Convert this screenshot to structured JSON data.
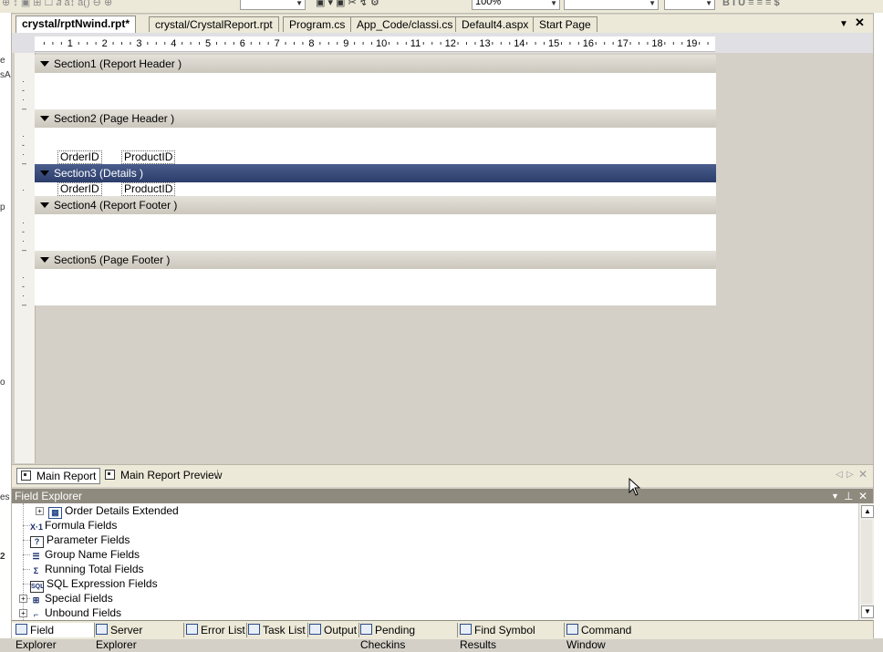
{
  "toolbar": {
    "zoom": "100%"
  },
  "doc_tabs": [
    {
      "label": "crystal/rptNwind.rpt*",
      "active": true
    },
    {
      "label": "crystal/CrystalReport.rpt"
    },
    {
      "label": "Program.cs"
    },
    {
      "label": "App_Code/classi.cs"
    },
    {
      "label": "Default4.aspx"
    },
    {
      "label": "Start Page"
    }
  ],
  "ruler": {
    "numbers": [
      "1",
      "2",
      "3",
      "4",
      "5",
      "6",
      "7",
      "8",
      "9",
      "10",
      "11",
      "12",
      "13",
      "14",
      "15",
      "16",
      "17",
      "18",
      "19"
    ]
  },
  "sections": [
    {
      "label": "Section1 (Report Header  )"
    },
    {
      "label": "Section2 (Page Header  )"
    },
    {
      "label": "Section3 (Details  )"
    },
    {
      "label": "Section4 (Report Footer  )"
    },
    {
      "label": "Section5 (Page Footer  )"
    }
  ],
  "fields": {
    "header_order": "OrderID",
    "header_product": "ProductID",
    "detail_order": "OrderID",
    "detail_product": "ProductID"
  },
  "report_tabs": {
    "main": "Main Report",
    "preview": "Main Report Preview"
  },
  "field_explorer": {
    "title": "Field Explorer",
    "items": [
      {
        "label": "Order Details Extended",
        "icon": "table-icon"
      },
      {
        "label": "Formula Fields",
        "icon": "formula-icon"
      },
      {
        "label": "Parameter Fields",
        "icon": "parameter-icon"
      },
      {
        "label": "Group Name Fields",
        "icon": "group-name-icon"
      },
      {
        "label": "Running Total Fields",
        "icon": "sigma-icon"
      },
      {
        "label": "SQL Expression Fields",
        "icon": "sql-icon"
      },
      {
        "label": "Special Fields",
        "icon": "special-icon"
      },
      {
        "label": "Unbound Fields",
        "icon": "unbound-icon"
      }
    ]
  },
  "bottom_tabs": [
    {
      "label": "Field Explorer",
      "active": true
    },
    {
      "label": "Server Explorer"
    },
    {
      "label": "Error List"
    },
    {
      "label": "Task List"
    },
    {
      "label": "Output"
    },
    {
      "label": "Pending Checkins"
    },
    {
      "label": "Find Symbol Results"
    },
    {
      "label": "Command Window"
    }
  ],
  "left_gutter_letters": [
    "e",
    "sA",
    "p",
    "o",
    "2",
    "es"
  ]
}
